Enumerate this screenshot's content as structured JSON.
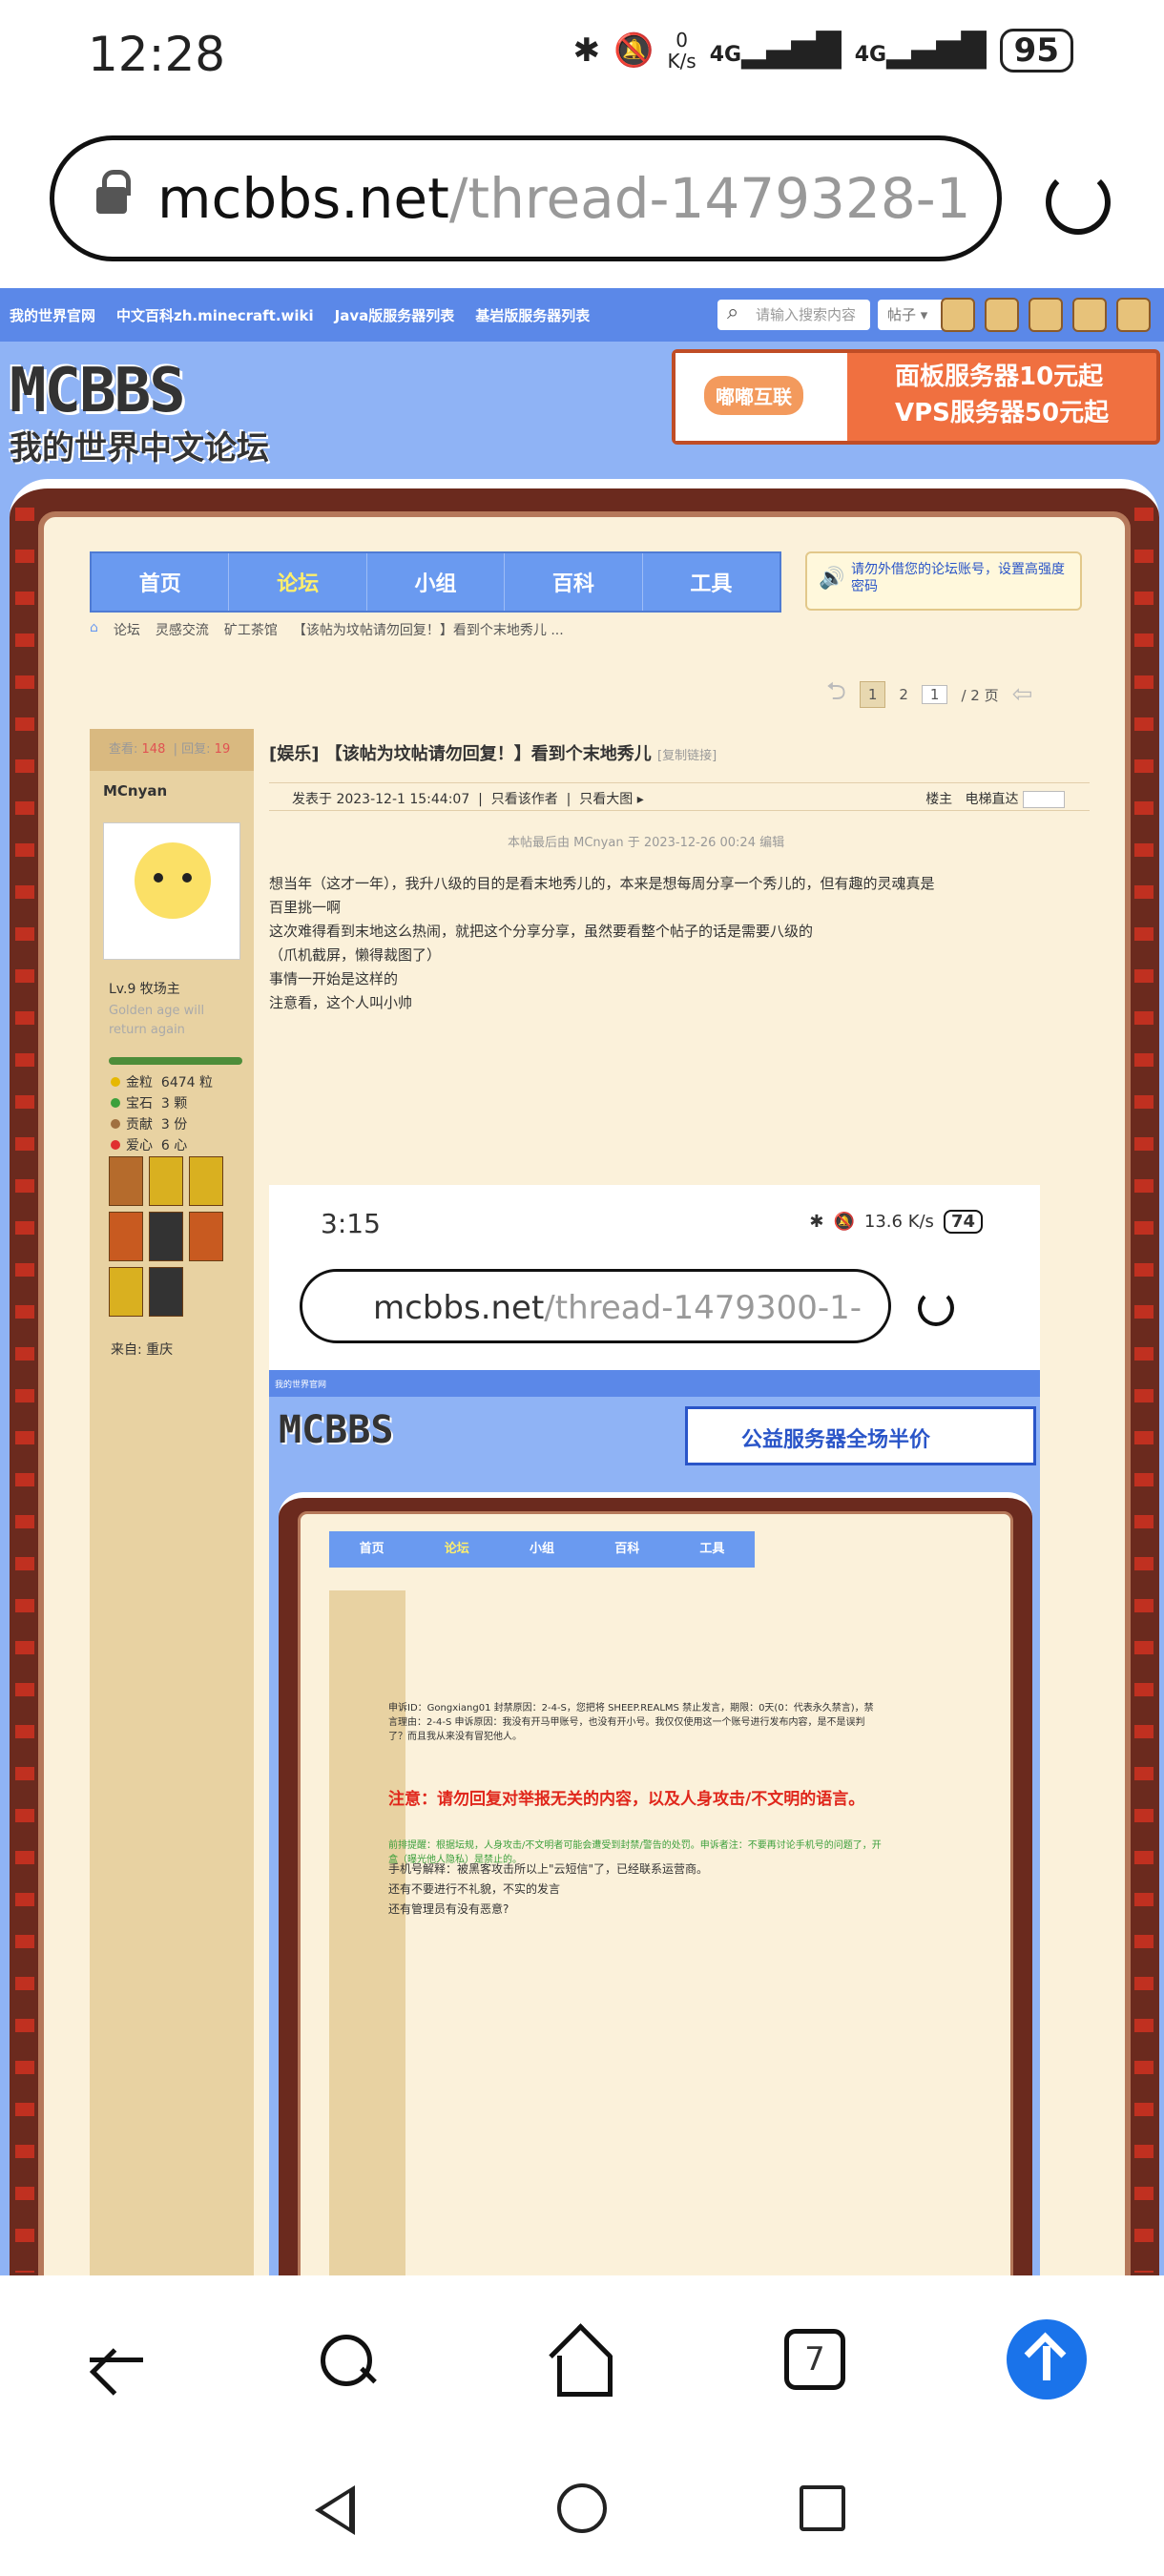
{
  "status_bar": {
    "time": "12:28",
    "net_speed": "0",
    "net_unit": "K/s",
    "signal1": "4G",
    "signal2": "4G",
    "battery": "95"
  },
  "browser": {
    "url_host": "mcbbs.net",
    "url_path": "/thread-1479328-1-"
  },
  "site": {
    "top_links": [
      "我的世界官网",
      "中文百科zh.minecraft.wiki",
      "Java版服务器列表",
      "基岩版服务器列表"
    ],
    "search_placeholder": "请输入搜索内容",
    "search_scope": "帖子",
    "logo_line1": "MCBBS",
    "logo_line2": "我的世界中文论坛",
    "ad_badge": "嘟嘟互联",
    "ad_line1": "面板服务器10元起",
    "ad_line2": "VPS服务器50元起",
    "nav": [
      "首页",
      "论坛",
      "小组",
      "百科",
      "工具"
    ],
    "notice": "请勿外借您的论坛账号，设置高强度密码",
    "breadcrumbs": [
      "论坛",
      "灵感交流",
      "矿工茶馆",
      "【该帖为坟帖请勿回复！】看到个末地秀儿 ..."
    ],
    "pager": {
      "current": "1",
      "next": "2",
      "input": "1",
      "total": "/ 2 页"
    }
  },
  "post": {
    "views_label": "查看:",
    "views": "148",
    "replies_label": "回复:",
    "replies": "19",
    "author": "MCnyan",
    "level": "Lv.9 牧场主",
    "motto": "Golden age will return again",
    "stats": [
      {
        "label": "金粒",
        "value": "6474 粒",
        "color": "#e6b800"
      },
      {
        "label": "宝石",
        "value": "3 颗",
        "color": "#3ca03c"
      },
      {
        "label": "贡献",
        "value": "3 份",
        "color": "#a07040"
      },
      {
        "label": "爱心",
        "value": "6 心",
        "color": "#e03030"
      }
    ],
    "from": "来自: 重庆",
    "title": "[娱乐] 【该帖为坟帖请勿回复！】看到个末地秀儿",
    "copy_link": "[复制链接]",
    "posted_at": "发表于 2023-12-1 15:44:07",
    "only_author": "只看该作者",
    "view_big": "只看大图",
    "floor": "楼主",
    "elevator": "电梯直达",
    "edited": "本帖最后由 MCnyan 于 2023-12-26 00:24 编辑",
    "body_lines": [
      "想当年（这才一年），我升八级的目的是看末地秀儿的，本来是想每周分享一个秀儿的，但有趣的灵魂真是",
      "百里挑一啊",
      "这次难得看到末地这么热闹，就把这个分享分享，虽然要看整个帖子的话是需要八级的",
      "（爪机截屏，懒得裁图了）",
      "事情一开始是这样的",
      "注意看，这个人叫小帅"
    ]
  },
  "embedded": {
    "time": "3:15",
    "speed": "13.6 K/s",
    "battery": "74",
    "url_host": "mcbbs.net",
    "url_path": "/thread-1479300-1-",
    "ad_text": "公益服务器全场半价",
    "nav": [
      "首页",
      "论坛",
      "小组",
      "百科",
      "工具"
    ],
    "text_block": "申诉ID：Gongxiang01 封禁原因：2-4-S，您把将 SHEEP.REALMS 禁止发言，期限：0天(0：代表永久禁言)，禁言理由：2-4-S 申诉原因：我没有开马甲账号，也没有开小号。我仅仅使用这一个账号进行发布内容，是不是误判了？而且我从来没有冒犯他人。",
    "warning": "注意：请勿回复对举报无关的内容，以及人身攻击/不文明的语言。",
    "green_text": "前排提醒：根据坛规，人身攻击/不文明者可能会遭受到封禁/警告的处罚。申诉者注：不要再讨论手机号的问题了，开盒（曝光他人隐私）是禁止的。",
    "text_lines": [
      "手机号解释：被黑客攻击所以上\"云短信\"了，已经联系运营商。",
      "还有不要进行不礼貌，不实的发言",
      "还有管理员有没有恶意?"
    ]
  },
  "bottom_nav": {
    "tabs_count": "7"
  }
}
